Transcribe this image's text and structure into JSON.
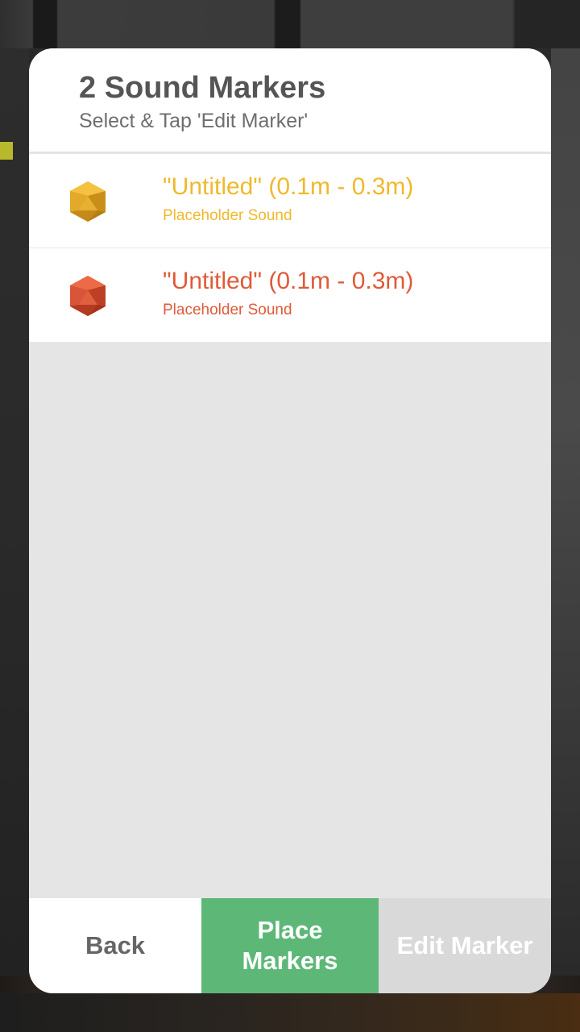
{
  "header": {
    "title": "2 Sound Markers",
    "subtitle": "Select & Tap 'Edit Marker'"
  },
  "markers": [
    {
      "name": "\"Untitled\" (0.1m - 0.3m)",
      "sound": "Placeholder Sound",
      "color": "#f0b92c",
      "icon": "yellow-icosahedron-icon"
    },
    {
      "name": "\"Untitled\" (0.1m - 0.3m)",
      "sound": "Placeholder Sound",
      "color": "#e05a38",
      "icon": "red-icosahedron-icon"
    }
  ],
  "buttons": {
    "back": "Back",
    "place": "Place Markers",
    "edit": "Edit Marker"
  },
  "colors": {
    "place_button": "#5db878",
    "edit_button_disabled": "#d9d9d9",
    "title": "#555555"
  }
}
